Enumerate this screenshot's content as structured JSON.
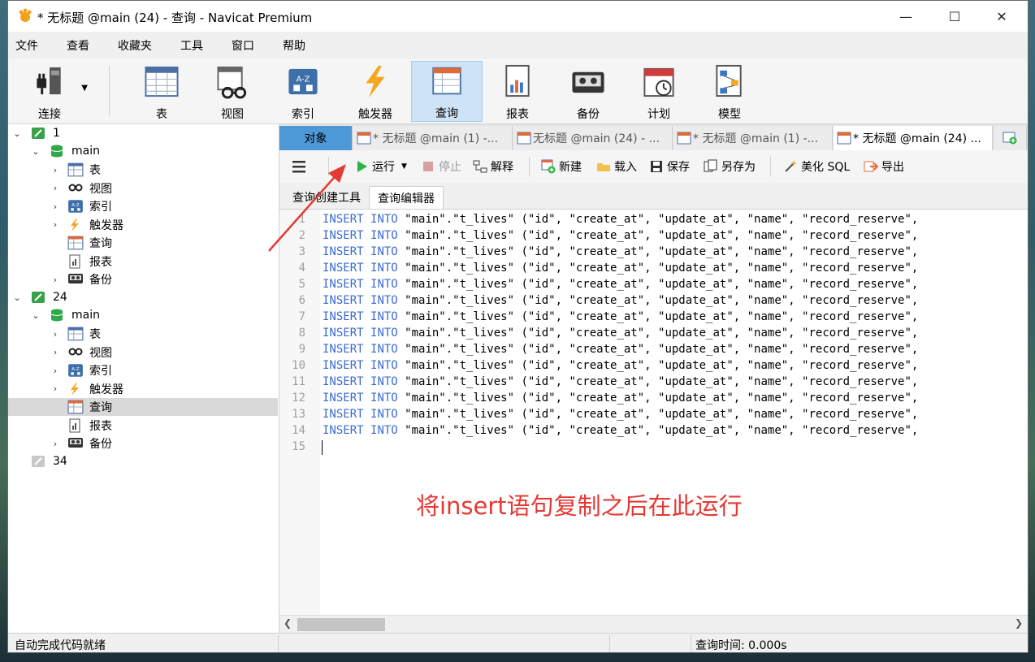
{
  "window": {
    "title": "* 无标题 @main (24) - 查询 - Navicat Premium",
    "minimize": "—",
    "maximize": "☐",
    "close": "✕"
  },
  "menu": [
    "文件",
    "查看",
    "收藏夹",
    "工具",
    "窗口",
    "帮助"
  ],
  "toolbar": {
    "connect": "连接",
    "table": "表",
    "view": "视图",
    "index": "索引",
    "trigger": "触发器",
    "query": "查询",
    "report": "报表",
    "backup": "备份",
    "schedule": "计划",
    "model": "模型"
  },
  "tree": {
    "conn1": "1",
    "db1": "main",
    "conn1_items": [
      "表",
      "视图",
      "索引",
      "触发器",
      "查询",
      "报表",
      "备份"
    ],
    "conn2": "24",
    "db2": "main",
    "conn2_items": [
      "表",
      "视图",
      "索引",
      "触发器",
      "查询",
      "报表",
      "备份"
    ],
    "conn3": "34"
  },
  "tabs": {
    "objects": "对象",
    "items": [
      "* 无标题 @main (1) -...",
      "无标题 @main (24) - ...",
      "* 无标题 @main (1) -...",
      "* 无标题 @main (24) ..."
    ]
  },
  "query_toolbar": {
    "run": "运行",
    "stop": "停止",
    "explain": "解释",
    "new": "新建",
    "load": "载入",
    "save": "保存",
    "save_as": "另存为",
    "beautify": "美化 SQL",
    "export": "导出"
  },
  "subtabs": {
    "builder": "查询创建工具",
    "editor": "查询编辑器"
  },
  "editor": {
    "keyword1": "INSERT",
    "keyword2": "INTO",
    "rest": " \"main\".\"t_lives\" (\"id\", \"create_at\", \"update_at\", \"name\", \"record_reserve\",",
    "line_count": 15
  },
  "annotation": "将insert语句复制之后在此运行",
  "status": {
    "left": "自动完成代码就绪",
    "right": "查询时间: 0.000s"
  },
  "colors": {
    "objects_tab": "#4d98d7",
    "keyword": "#3a6bd0",
    "annotation": "#e53935",
    "run_icon": "#2fb344"
  }
}
